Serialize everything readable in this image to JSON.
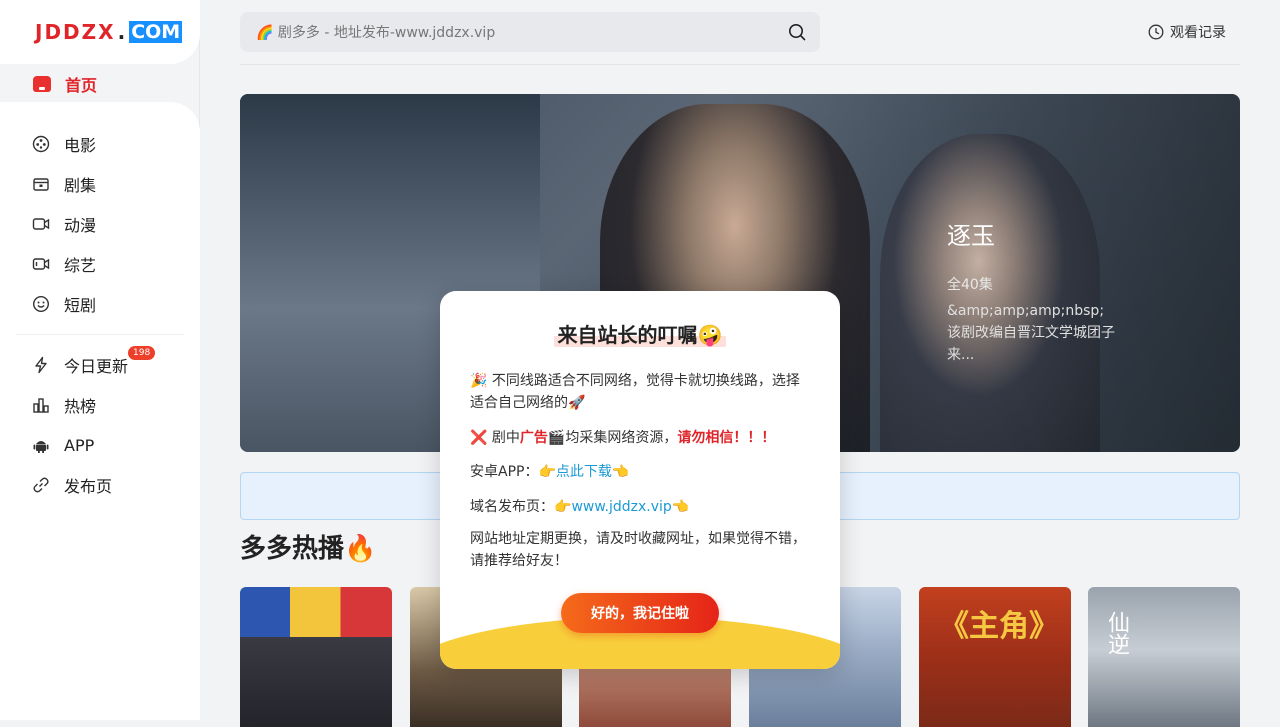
{
  "logo": {
    "part1": "JDDZX",
    "dot": ".",
    "part2": "COM"
  },
  "nav": {
    "home": "首页",
    "items": [
      "电影",
      "剧集",
      "动漫",
      "综艺",
      "短剧"
    ],
    "items2": [
      "今日更新",
      "热榜",
      "APP",
      "发布页"
    ],
    "badge": "198"
  },
  "search": {
    "placeholder": "🌈 剧多多 - 地址发布-www.jddzx.vip"
  },
  "header": {
    "history": "观看记录"
  },
  "banner": {
    "title": "逐玉",
    "episodes": "全40集",
    "desc": "&amp;amp;amp;nbsp;该剧改编自晋江文学城团子来..."
  },
  "section": {
    "title": "多多热播🔥"
  },
  "posters": [
    {
      "text": ""
    },
    {
      "text": ""
    },
    {
      "text": ""
    },
    {
      "text": ""
    },
    {
      "text": "《主角》"
    },
    {
      "text": "仙逆"
    }
  ],
  "modal": {
    "title": "来自站长的叮嘱🤪",
    "line1": "🎉 不同线路适合不同网络，觉得卡就切换线路，选择适合自己网络的🚀",
    "line2_a": "❌ 剧中",
    "line2_b": "广告",
    "line2_c": "🎬均采集网络资源，",
    "line2_d": "请勿相信！！！",
    "line3_a": "安卓APP：👉",
    "line3_b": "点此下载",
    "line3_c": "👈",
    "line4_a": "域名发布页：👉",
    "line4_b": "www.jddzx.vip",
    "line4_c": "👈",
    "line5": "网站地址定期更换，请及时收藏网址，如果觉得不错，请推荐给好友！",
    "button": "好的，我记住啦"
  },
  "colors": {
    "brand_red": "#e0252a",
    "link_blue": "#1c9ad6",
    "logo_blue": "#1890ff",
    "wave_yellow": "#f8cf3b"
  }
}
